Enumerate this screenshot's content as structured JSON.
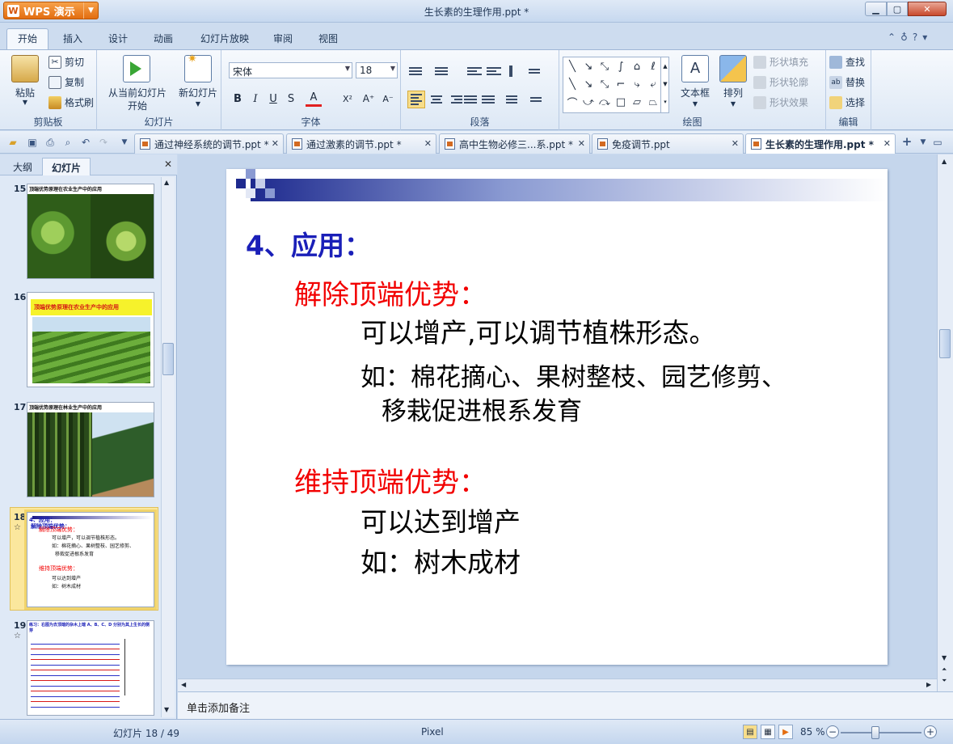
{
  "app": {
    "name": "WPS 演示",
    "logo_letter": "W",
    "doc_title": "生长素的生理作用.ppt *"
  },
  "ribbon_tabs": [
    "开始",
    "插入",
    "设计",
    "动画",
    "幻灯片放映",
    "审阅",
    "视图"
  ],
  "ribbon": {
    "clipboard": {
      "paste": "粘贴",
      "cut": "剪切",
      "copy": "复制",
      "format_painter": "格式刷",
      "label": "剪贴板"
    },
    "slides": {
      "from_current_l1": "从当前幻灯片",
      "from_current_l2": "开始",
      "new_slide": "新幻灯片",
      "label": "幻灯片"
    },
    "font": {
      "name": "宋体",
      "size": "18",
      "bold": "B",
      "italic": "I",
      "underline": "U",
      "shadow": "S",
      "color": "A",
      "superscript": "X²",
      "grow": "A⁺",
      "shrink": "A⁻",
      "label": "字体"
    },
    "paragraph": {
      "label": "段落"
    },
    "drawing": {
      "textbox": "文本框",
      "arrange": "排列",
      "fill": "形状填充",
      "outline": "形状轮廓",
      "effect": "形状效果",
      "label": "绘图"
    },
    "editing": {
      "find": "查找",
      "replace": "替换",
      "select": "选择",
      "label": "编辑"
    }
  },
  "doc_tabs": [
    {
      "label": "通过神经系统的调节.ppt *"
    },
    {
      "label": "通过激素的调节.ppt *"
    },
    {
      "label": "高中生物必修三...系.ppt *"
    },
    {
      "label": "免疫调节.ppt"
    },
    {
      "label": "生长素的生理作用.ppt *"
    }
  ],
  "left_panel": {
    "tab_outline": "大纲",
    "tab_slides": "幻灯片",
    "thumbs": [
      {
        "num": "15",
        "title": "顶端优势原理在农业生产中的应用"
      },
      {
        "num": "16",
        "title": "顶端优势原理在农业生产中的应用"
      },
      {
        "num": "17",
        "title": "顶端优势原理在林业生产中的应用"
      },
      {
        "num": "18",
        "title": "4、应用："
      },
      {
        "num": "19",
        "title": "练习：右图为去顶端的杂木上端 A、B、C、D 分别为其上生长的侧芽"
      }
    ],
    "thumb18": {
      "l1": "解除顶端优势：",
      "l2": "可以增产，可以调节植株形态。",
      "l3": "如：棉花摘心、果树整枝、园艺修剪、",
      "l4": "移栽促进根系发育",
      "l5": "维持顶端优势：",
      "l6": "可以达到增产",
      "l7": "如：树木成材"
    }
  },
  "slide": {
    "heading": "4、应用：",
    "section1_title": "解除顶端优势：",
    "section1_line1": "可以增产,可以调节植株形态。",
    "section1_line2": "如：棉花摘心、果树整枝、园艺修剪、",
    "section1_line3": "移栽促进根系发育",
    "section2_title": "维持顶端优势：",
    "section2_line1": "可以达到增产",
    "section2_line2": "如：树木成材"
  },
  "notes_placeholder": "单击添加备注",
  "status": {
    "slide_count": "幻灯片 18 / 49",
    "theme": "Pixel",
    "zoom": "85 %"
  },
  "colors": {
    "heading": "#1a1fb8",
    "red": "#f20000",
    "body": "#000000",
    "accent_orange": "#e36d10"
  }
}
